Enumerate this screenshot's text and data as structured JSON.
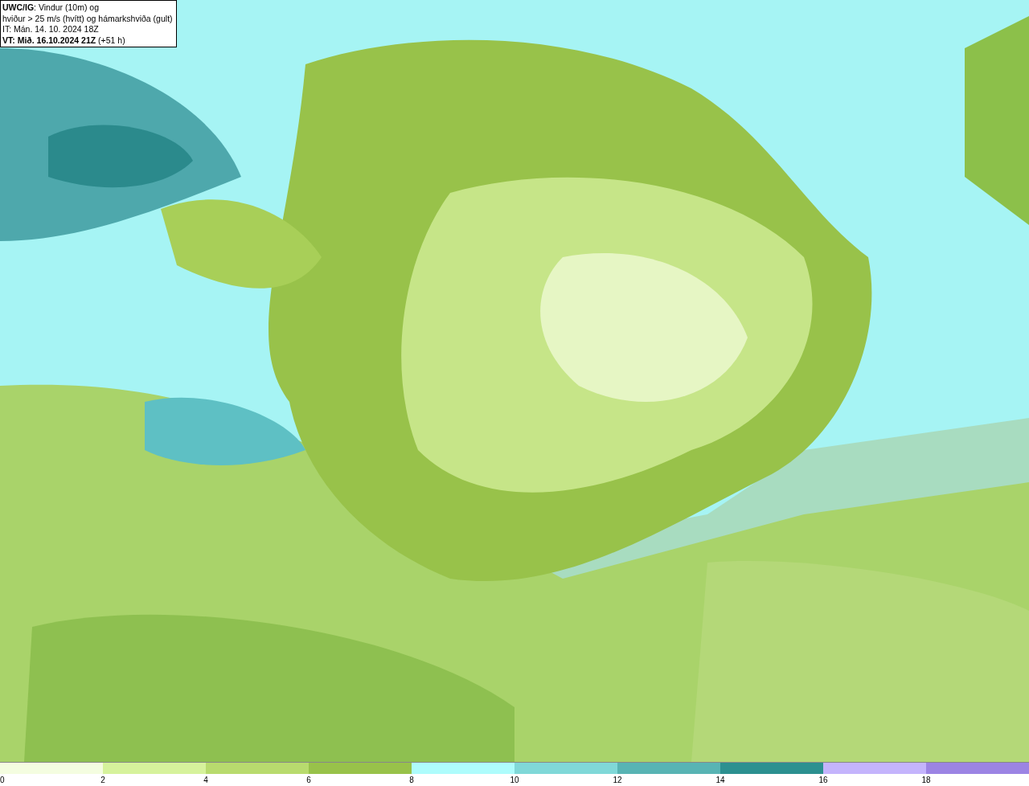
{
  "title_box": {
    "lines": [
      "**UWC/IG**: Vindur (10m) og",
      "hviður > 25 m/s (hvítt) og hámarkshviða (gult)",
      "IT: Mán. 14. 10. 2024 18Z",
      "**VT: Mið. 16.10.2024 21Z** (+51 h)"
    ]
  },
  "legend": {
    "segments": [
      {
        "color": "#f4fde0"
      },
      {
        "color": "#d6f29c"
      },
      {
        "color": "#b8db6e"
      },
      {
        "color": "#98c24a"
      },
      {
        "color": "#aefcfc"
      },
      {
        "color": "#80d8d8"
      },
      {
        "color": "#58b4b4"
      },
      {
        "color": "#2c9090"
      },
      {
        "color": "#c4b4fc"
      },
      {
        "color": "#9c84e4"
      }
    ],
    "labels": [
      "0",
      "2",
      "4",
      "6",
      "8",
      "10",
      "12",
      "14",
      "16",
      "18"
    ]
  }
}
